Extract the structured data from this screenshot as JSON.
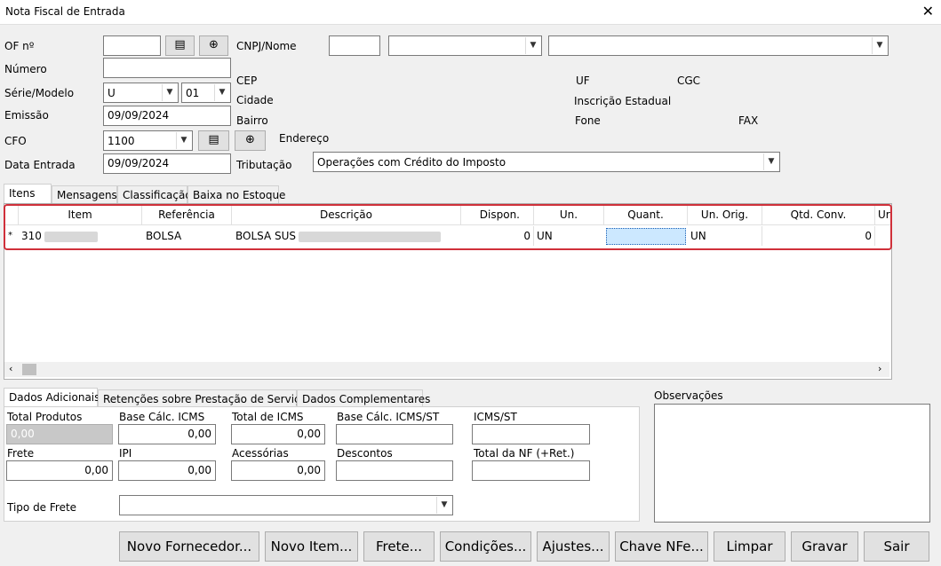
{
  "window": {
    "title": "Nota Fiscal de Entrada"
  },
  "form": {
    "of_label": "OF nº",
    "numero_label": "Número",
    "serie_label": "Série/Modelo",
    "serie_value": "U",
    "modelo_value": "01",
    "emissao_label": "Emissão",
    "emissao_value": "09/09/2024",
    "cfo_label": "CFO",
    "cfo_value": "1100",
    "data_entrada_label": "Data Entrada",
    "data_entrada_value": "09/09/2024",
    "cnpj_label": "CNPJ/Nome",
    "cep_label": "CEP",
    "cidade_label": "Cidade",
    "bairro_label": "Bairro",
    "endereco_label": "Endereço",
    "uf_label": "UF",
    "cgc_label": "CGC",
    "inscricao_label": "Inscrição Estadual",
    "fone_label": "Fone",
    "fax_label": "FAX",
    "tributacao_label": "Tributação",
    "tributacao_value": "Operações com Crédito do Imposto"
  },
  "tabs": [
    "Itens",
    "Mensagens",
    "Classificação",
    "Baixa no Estoque"
  ],
  "grid": {
    "columns": [
      "Item",
      "Referência",
      "Descrição",
      "Dispon.",
      "Un.",
      "Quant.",
      "Un. Orig.",
      "Qtd. Conv.",
      "Ur"
    ],
    "row": {
      "marker": "*",
      "item": "310",
      "referencia": "BOLSA",
      "descricao": "BOLSA SUS",
      "dispon": "0",
      "un": "UN",
      "quant": "",
      "un_orig": "UN",
      "qtd_conv": "0"
    }
  },
  "bottom_tabs": [
    "Dados Adicionais",
    "Retenções sobre Prestação de Serviços",
    "Dados Complementares"
  ],
  "totals": {
    "total_produtos_label": "Total Produtos",
    "total_produtos_value": "0,00",
    "base_icms_label": "Base Cálc. ICMS",
    "base_icms_value": "0,00",
    "total_icms_label": "Total de ICMS",
    "total_icms_value": "0,00",
    "base_icms_st_label": "Base Cálc. ICMS/ST",
    "icms_st_label": "ICMS/ST",
    "frete_label": "Frete",
    "frete_value": "0,00",
    "ipi_label": "IPI",
    "ipi_value": "0,00",
    "acessorias_label": "Acessórias",
    "acessorias_value": "0,00",
    "descontos_label": "Descontos",
    "total_nf_label": "Total da NF (+Ret.)",
    "tipo_frete_label": "Tipo de Frete"
  },
  "observacoes_label": "Observações",
  "buttons": [
    "Novo Fornecedor...",
    "Novo Item...",
    "Frete...",
    "Condições...",
    "Ajustes...",
    "Chave NFe...",
    "Limpar",
    "Gravar",
    "Sair"
  ],
  "colors": {
    "highlight_border": "#d0303a",
    "selected_cell": "#cce8ff"
  }
}
